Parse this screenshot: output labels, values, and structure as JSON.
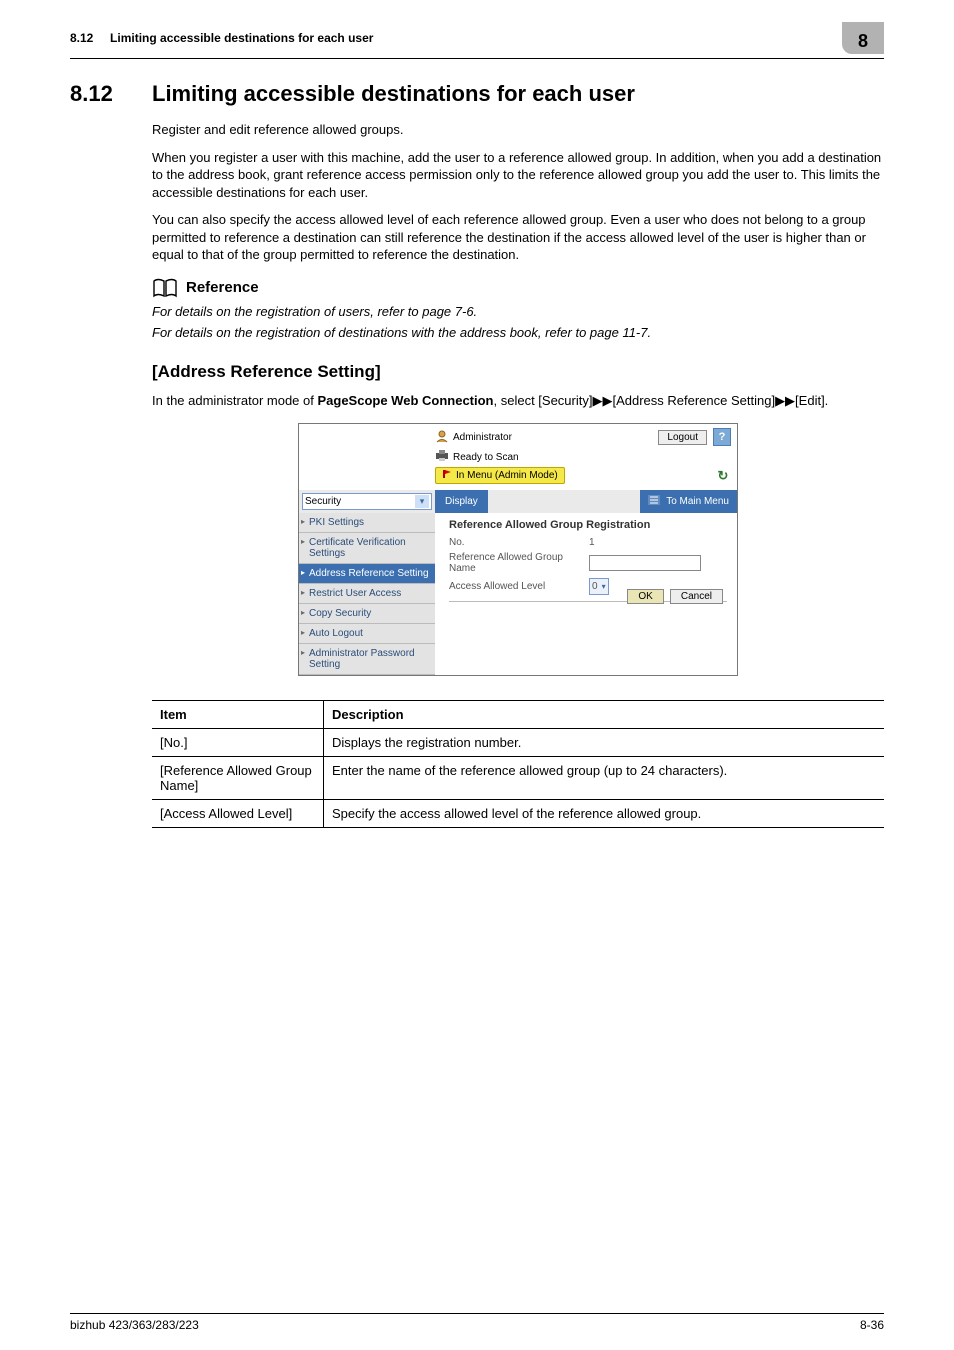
{
  "running_head": {
    "section": "8.12",
    "title": "Limiting accessible destinations for each user",
    "chapter": "8"
  },
  "section": {
    "number": "8.12",
    "title": "Limiting accessible destinations for each user"
  },
  "paragraphs": {
    "p1": "Register and edit reference allowed groups.",
    "p2": "When you register a user with this machine, add the user to a reference allowed group. In addition, when you add a destination to the address book, grant reference access permission only to the reference allowed group you add the user to. This limits the accessible destinations for each user.",
    "p3": "You can also specify the access allowed level of each reference allowed group. Even a user who does not belong to a group permitted to reference a destination can still reference the destination if the access allowed level of the user is higher than or equal to that of the group permitted to reference the destination."
  },
  "reference": {
    "heading": "Reference",
    "line1": "For details on the registration of users, refer to page 7-6.",
    "line2": "For details on the registration of destinations with the address book, refer to page 11-7."
  },
  "sub": {
    "title": "[Address Reference Setting]",
    "intro_prefix": "In the administrator mode of ",
    "intro_bold": "PageScope Web Connection",
    "intro_suffix": ", select [Security]▶▶[Address Reference Setting]▶▶[Edit]."
  },
  "screenshot": {
    "admin_label": "Administrator",
    "logout": "Logout",
    "help": "?",
    "status": "Ready to Scan",
    "mode": "In Menu (Admin Mode)",
    "refresh": "↻",
    "select_value": "Security",
    "display_btn": "Display",
    "to_main_menu": "To Main Menu",
    "side_items": [
      "PKI Settings",
      "Certificate Verification Settings",
      "Address Reference Setting",
      "Restrict User Access",
      "Copy Security",
      "Auto Logout",
      "Administrator Password Setting"
    ],
    "content_title": "Reference Allowed Group Registration",
    "rows": {
      "no_label": "No.",
      "no_value": "1",
      "ref_label": "Reference Allowed Group Name",
      "level_label": "Access Allowed Level",
      "level_value": "0"
    },
    "ok": "OK",
    "cancel": "Cancel"
  },
  "table": {
    "head_item": "Item",
    "head_desc": "Description",
    "rows": [
      {
        "item": "[No.]",
        "desc": "Displays the registration number."
      },
      {
        "item": "[Reference Allowed Group Name]",
        "desc": "Enter the name of the reference allowed group (up to 24 characters)."
      },
      {
        "item": "[Access Allowed Level]",
        "desc": "Specify the access allowed level of the reference allowed group."
      }
    ]
  },
  "footer": {
    "left": "bizhub 423/363/283/223",
    "right": "8-36"
  }
}
